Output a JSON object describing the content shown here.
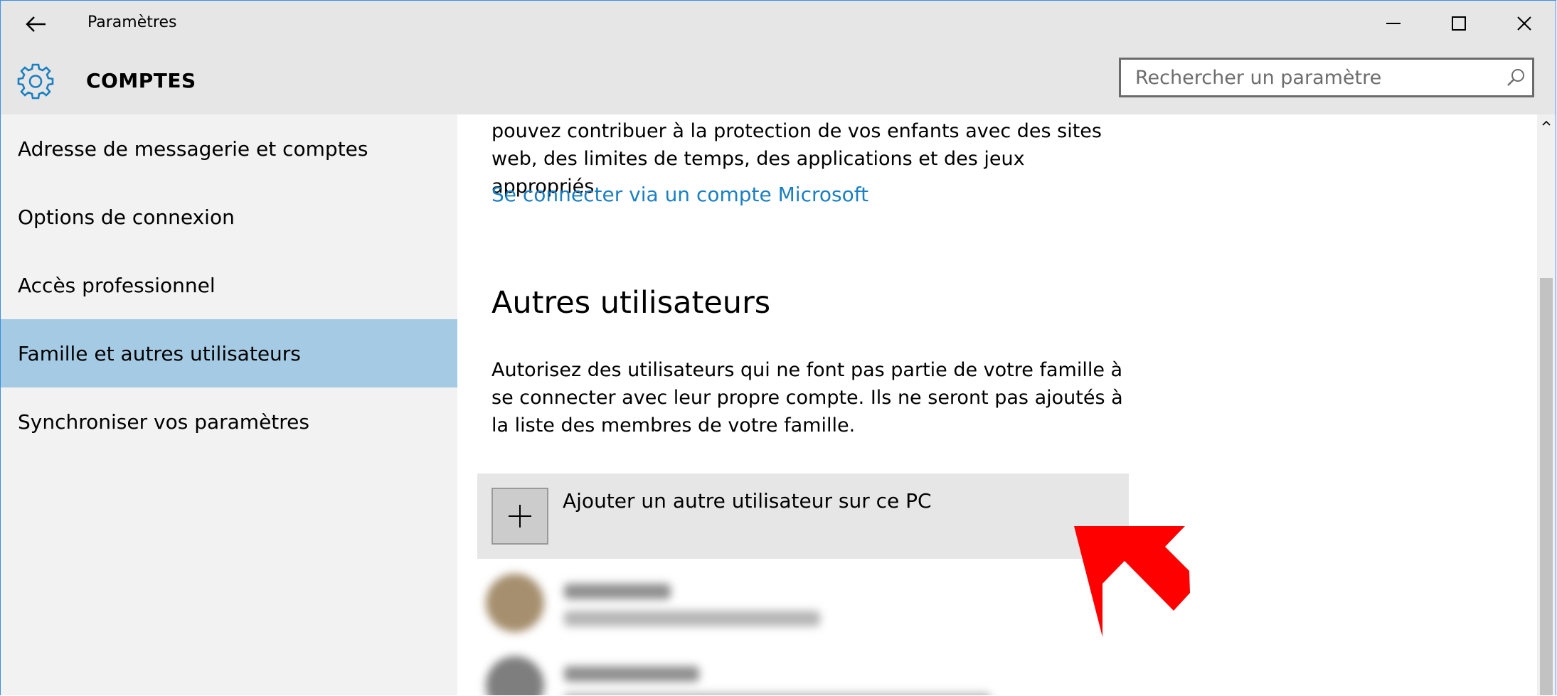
{
  "window": {
    "app_title": "Paramètres"
  },
  "header": {
    "section_title": "COMPTES",
    "search_placeholder": "Rechercher un paramètre"
  },
  "sidebar": {
    "items": [
      {
        "label": "Adresse de messagerie et comptes",
        "selected": false
      },
      {
        "label": "Options de connexion",
        "selected": false
      },
      {
        "label": "Accès professionnel",
        "selected": false
      },
      {
        "label": "Famille et autres utilisateurs",
        "selected": true
      },
      {
        "label": "Synchroniser vos paramètres",
        "selected": false
      }
    ]
  },
  "content": {
    "intro_text": "pouvez contribuer à la protection de vos enfants avec des sites web, des limites de temps, des applications et des jeux appropriés.",
    "signin_link": "Se connecter via un compte Microsoft",
    "other_users_heading": "Autres utilisateurs",
    "other_users_desc": "Autorisez des utilisateurs qui ne font pas partie de votre famille à se connecter avec leur propre compte. Ils ne seront pas ajoutés à la liste des membres de votre famille.",
    "add_user_label": "Ajouter un autre utilisateur sur ce PC"
  },
  "colors": {
    "accent": "#1b7fc1",
    "selected_nav": "#a5cae3",
    "annotation_arrow": "#ff0000"
  },
  "icons": {
    "back": "back-arrow-icon",
    "settings": "gear-icon",
    "search": "search-icon",
    "add": "plus-icon"
  }
}
